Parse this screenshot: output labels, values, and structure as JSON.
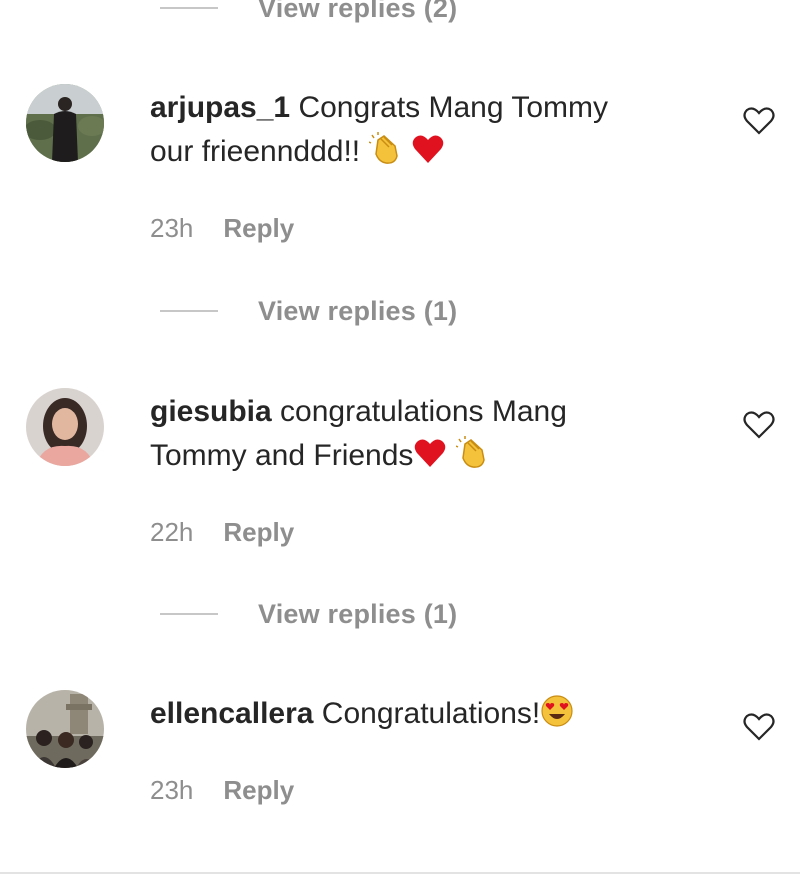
{
  "thread": {
    "top_view_replies": "View replies (2)",
    "comments": [
      {
        "username": "arjupas_1",
        "text_line1": "Congrats Mang Tommy",
        "text_line2": "our frieennddd!!",
        "emojis": [
          "clapping-hands",
          "red-heart"
        ],
        "time": "23h",
        "reply_label": "Reply",
        "view_replies": "View replies (1)"
      },
      {
        "username": "giesubia",
        "text_line1": "congratulations Mang",
        "text_line2": "Tommy and Friends",
        "emojis": [
          "red-heart",
          "clapping-hands"
        ],
        "time": "22h",
        "reply_label": "Reply",
        "view_replies": "View replies (1)"
      },
      {
        "username": "ellencallera",
        "text_line1": "Congratulations!",
        "emojis": [
          "heart-eyes-face"
        ],
        "time": "23h",
        "reply_label": "Reply"
      }
    ]
  },
  "icons": {
    "like": "heart-outline-icon"
  },
  "colors": {
    "text": "#262626",
    "secondary_text": "#8e8e8e",
    "heart_red": "#e0121f",
    "clap_yellow": "#f5c33b"
  }
}
